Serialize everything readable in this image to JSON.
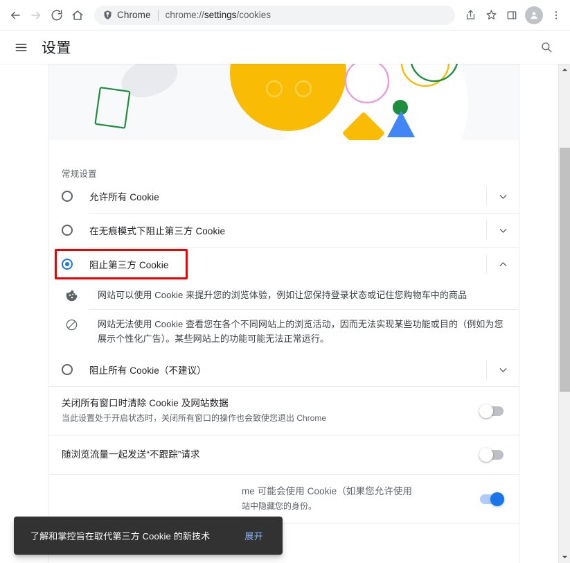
{
  "browser": {
    "nav": {
      "back_icon": "arrow-left-icon",
      "forward_icon": "arrow-right-icon",
      "reload_icon": "reload-icon",
      "home_icon": "home-icon"
    },
    "omnibox": {
      "chip_icon": "chrome-shield-icon",
      "chip_label": "Chrome",
      "url_prefix": "chrome://",
      "url_bold": "settings",
      "url_suffix": "/cookies",
      "full_url": "chrome://settings/cookies"
    },
    "toolbar": {
      "share_icon": "share-icon",
      "bookmark_icon": "star-icon",
      "side_panel_icon": "side-panel-icon",
      "profile_icon": "avatar-person-icon",
      "menu_icon": "three-dot-menu-icon"
    }
  },
  "settings_header": {
    "menu_icon": "hamburger-menu-icon",
    "title": "设置",
    "search_icon": "search-icon"
  },
  "hero": {
    "alt": "cookies-illustration-banner",
    "colors": {
      "yellow": "#fabb05",
      "blue": "#4285f4",
      "green": "#1e8e3e",
      "pink": "#e89ada",
      "gray": "#e8eaed",
      "background": "#f8f9fa"
    }
  },
  "general_section": {
    "title": "常规设置",
    "options": [
      {
        "label": "允许所有 Cookie",
        "selected": false,
        "expand_icon": "chevron-down-icon"
      },
      {
        "label": "在无痕模式下阻止第三方 Cookie",
        "selected": false,
        "expand_icon": "chevron-down-icon"
      },
      {
        "label": "阻止第三方 Cookie",
        "selected": true,
        "expand_icon": "chevron-up-icon",
        "highlighted": true
      },
      {
        "label": "阻止所有 Cookie（不建议）",
        "selected": false,
        "expand_icon": "chevron-down-icon"
      }
    ],
    "expanded_details": [
      {
        "icon": "cookie-icon",
        "text": "网站可以使用 Cookie 来提升您的浏览体验，例如让您保持登录状态或记住您购物车中的商品"
      },
      {
        "icon": "blocked-circle-icon",
        "text": "网站无法使用 Cookie 查看您在各个不同网站上的浏览活动，因而无法实现某些功能或目的（例如为您展示个性化广告）。某些网站上的功能可能无法正常运行。"
      }
    ]
  },
  "toggle_rows": [
    {
      "title": "关闭所有窗口时清除 Cookie 及网站数据",
      "subtitle": "当此设置处于开启状态时，关闭所有窗口的操作也会致使您退出 Chrome",
      "on": false
    },
    {
      "title": "随浏览流量一起发送“不跟踪”请求",
      "subtitle": "",
      "on": false
    },
    {
      "title": "me 可能会使用 Cookie（如果您允许使用",
      "subtitle": "站中隐藏您的身份。",
      "on": true
    }
  ],
  "toast": {
    "message": "了解和掌控旨在取代第三方 Cookie 的新技术",
    "action_label": "展开"
  },
  "scrollbar": {
    "up_icon": "scroll-up-arrow-icon",
    "down_icon": "scroll-down-arrow-icon",
    "thumb_label": "vertical-scroll-thumb"
  }
}
